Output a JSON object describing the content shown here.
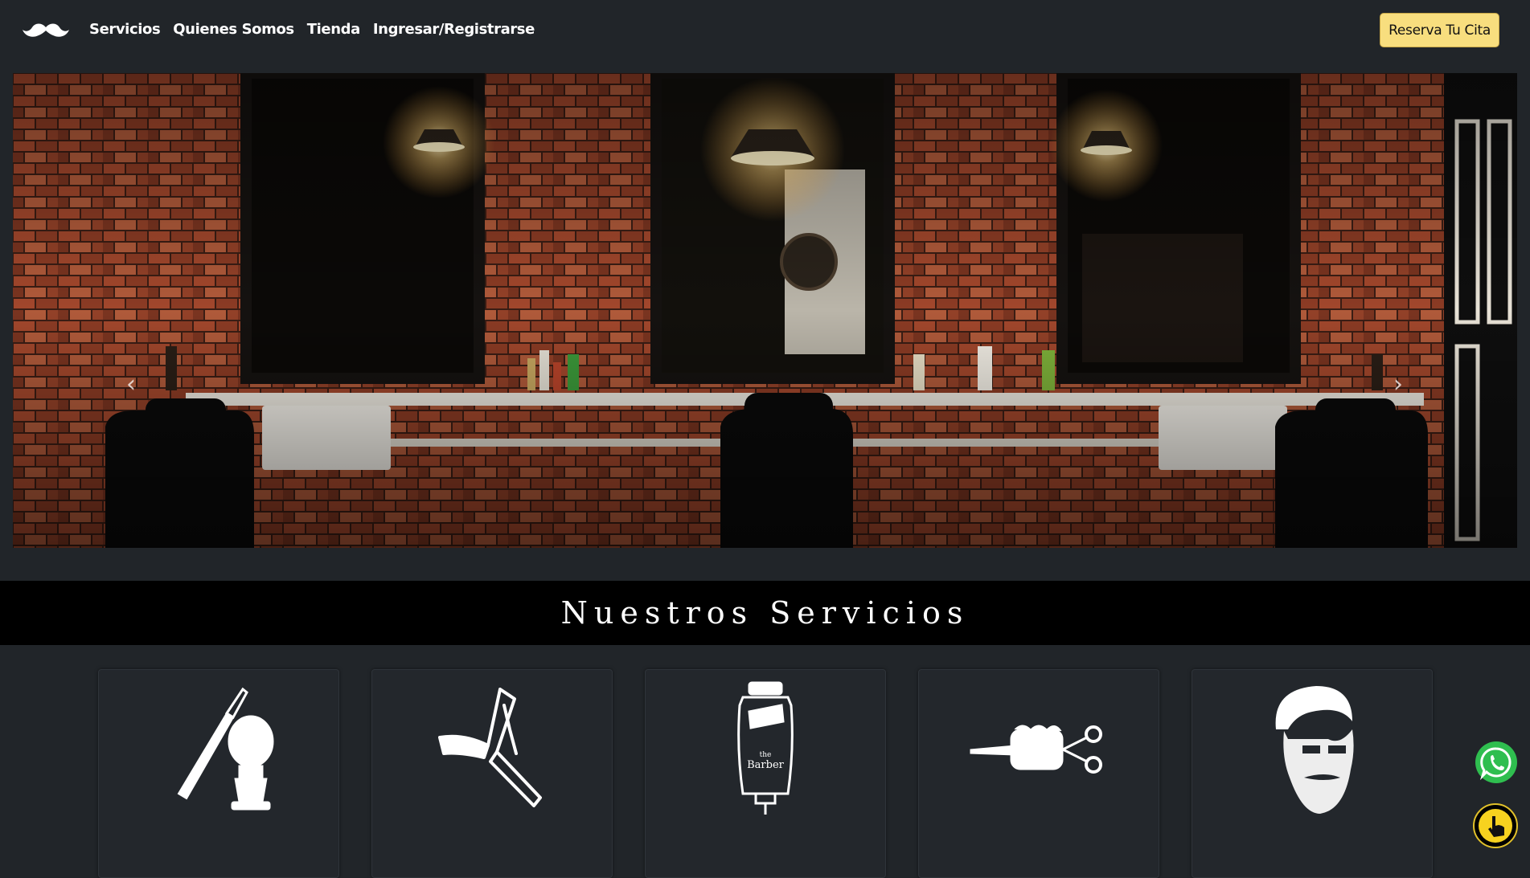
{
  "navbar": {
    "brand_icon": "mustache-icon",
    "links": [
      "Servicios",
      "Quienes Somos",
      "Tienda",
      "Ingresar/Registrarse"
    ],
    "cta_label": "Reserva Tu Cita",
    "cta_color": "#f8de7e"
  },
  "hero": {
    "image": "barbershop-interior-photo",
    "prev_icon": "chevron-left-icon",
    "next_icon": "chevron-right-icon",
    "prev_glyph": "‹",
    "next_glyph": "›"
  },
  "services": {
    "title": "Nuestros Servicios",
    "cards": [
      {
        "icon": "razor-and-brush-icon"
      },
      {
        "icon": "straight-razor-icon"
      },
      {
        "icon": "hair-clipper-icon",
        "icon_text_1": "the",
        "icon_text_2": "Barber"
      },
      {
        "icon": "fist-scissors-comb-icon"
      },
      {
        "icon": "bearded-man-icon"
      }
    ]
  },
  "floating": {
    "whatsapp_icon": "whatsapp-icon",
    "hand_icon": "pointer-hand-icon"
  },
  "colors": {
    "background": "#212529",
    "band": "#000000",
    "accent": "#f8de7e",
    "whatsapp": "#2fbe4f"
  }
}
